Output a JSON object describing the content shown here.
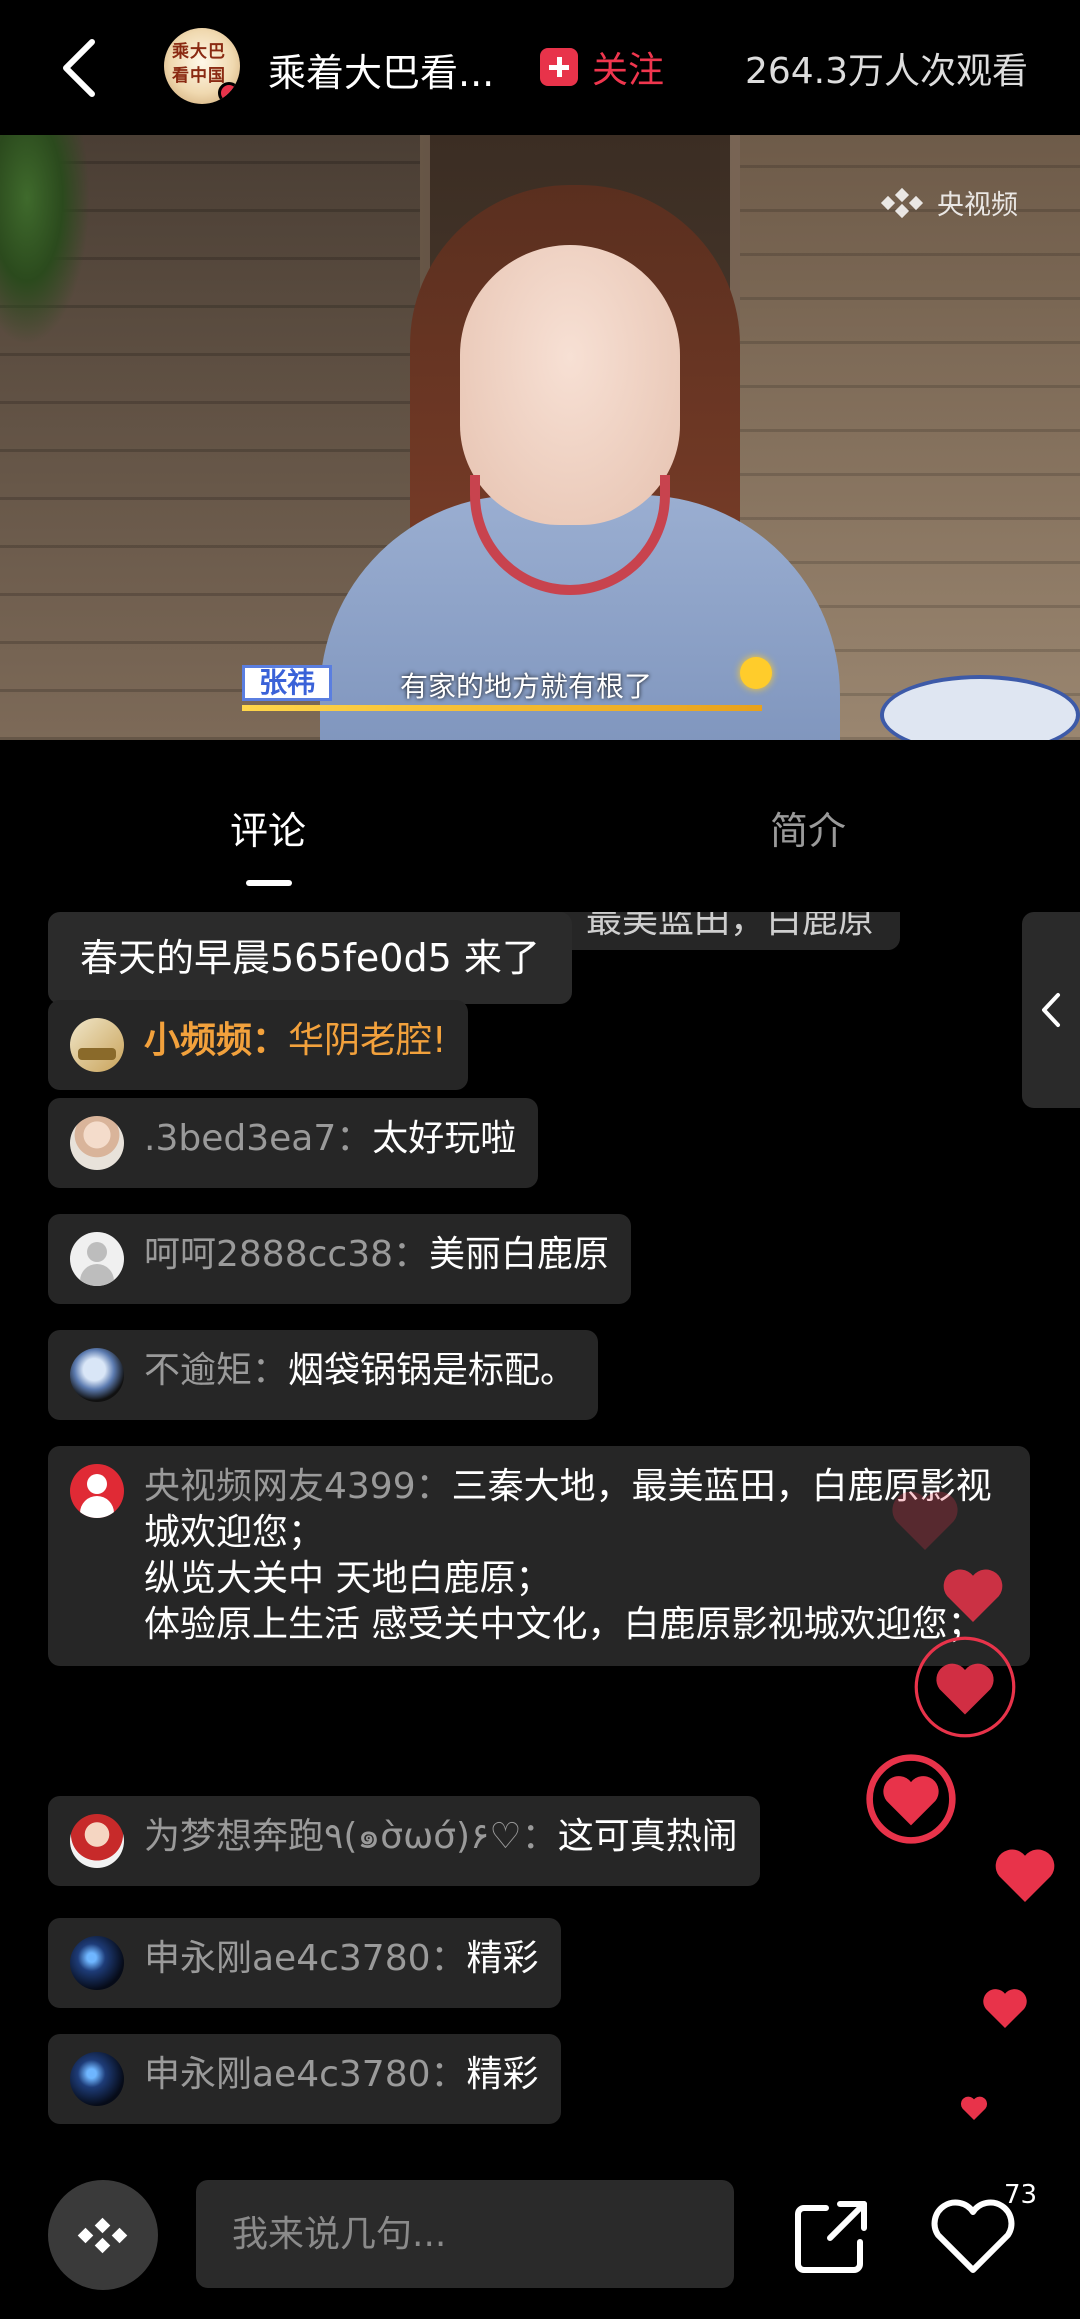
{
  "header": {
    "channel_title": "乘着大巴看...",
    "avatar_text": "乘着大巴看中国",
    "follow_label": "关注",
    "views": "264.3万人次观看"
  },
  "video": {
    "watermark": "央视频",
    "name_tag": "张祎",
    "subtitle": "有家的地方就有根了"
  },
  "tabs": [
    {
      "label": "评论",
      "active": true
    },
    {
      "label": "简介",
      "active": false
    }
  ],
  "comments": {
    "clipped_top": "最美蓝田，白鹿原",
    "join_message": "春天的早晨565fe0d5 来了",
    "items": [
      {
        "user": "小频频",
        "sep": "：",
        "text": "华阴老腔!",
        "highlight": true
      },
      {
        "user": ".3bed3ea7",
        "sep": "：",
        "text": "太好玩啦",
        "highlight": false
      },
      {
        "user": "呵呵2888cc38",
        "sep": "：",
        "text": "美丽白鹿原",
        "highlight": false
      },
      {
        "user": "不逾矩",
        "sep": "：",
        "text": "烟袋锅锅是标配。",
        "highlight": false
      },
      {
        "user": "央视频网友4399",
        "sep": "：",
        "text": "三秦大地，最美蓝田，白鹿原影视城欢迎您；\n纵览大关中 天地白鹿原；\n体验原上生活 感受关中文化，白鹿原影视城欢迎您；",
        "highlight": false
      },
      {
        "user": "为梦想奔跑٩(๑σ̀ωσ́)۶♡",
        "sep": "：",
        "text": "这可真热闹",
        "highlight": false
      },
      {
        "user": "申永刚ae4c3780",
        "sep": "：",
        "text": "精彩",
        "highlight": false
      },
      {
        "user": "申永刚ae4c3780",
        "sep": "：",
        "text": "精彩",
        "highlight": false
      }
    ]
  },
  "bottom": {
    "input_placeholder": "我来说几句...",
    "like_count": "73"
  },
  "colors": {
    "accent_red": "#e8334a",
    "highlight_orange": "#f2a13c",
    "bubble_bg": "#262626"
  }
}
